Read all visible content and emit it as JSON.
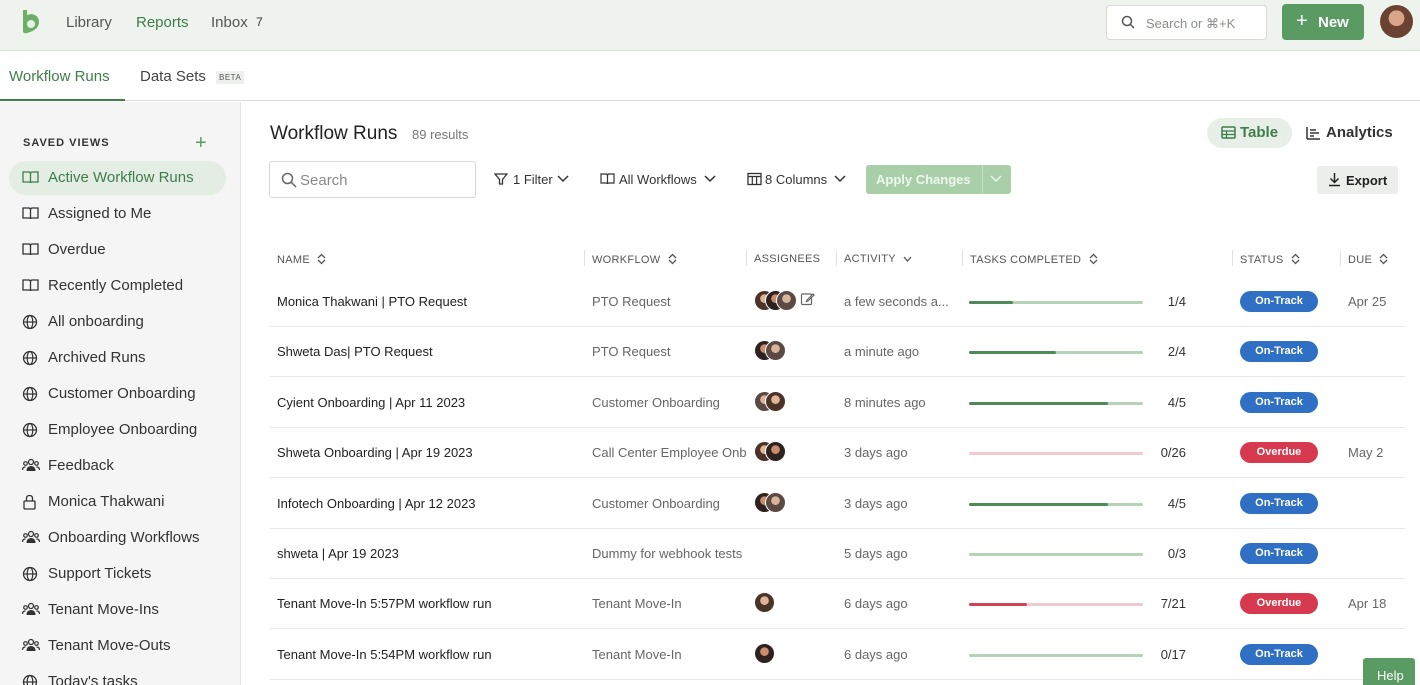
{
  "topnav": {
    "links": [
      "Library",
      "Reports",
      "Inbox"
    ],
    "active": "Reports",
    "inbox_count": "7",
    "search_placeholder": "Search or ⌘+K",
    "new_label": "New"
  },
  "subtabs": {
    "workflow_runs": "Workflow Runs",
    "data_sets": "Data Sets",
    "beta": "BETA"
  },
  "sidebar": {
    "heading": "SAVED VIEWS",
    "add": "+",
    "items": [
      {
        "label": "Active Workflow Runs",
        "icon": "book-icon",
        "active": true
      },
      {
        "label": "Assigned to Me",
        "icon": "book-icon"
      },
      {
        "label": "Overdue",
        "icon": "book-icon"
      },
      {
        "label": "Recently Completed",
        "icon": "book-icon"
      },
      {
        "label": "All onboarding",
        "icon": "globe-icon"
      },
      {
        "label": "Archived Runs",
        "icon": "globe-icon"
      },
      {
        "label": "Customer Onboarding",
        "icon": "globe-icon"
      },
      {
        "label": "Employee Onboarding",
        "icon": "globe-icon"
      },
      {
        "label": "Feedback",
        "icon": "team-icon"
      },
      {
        "label": "Monica Thakwani",
        "icon": "lock-icon"
      },
      {
        "label": "Onboarding Workflows",
        "icon": "team-icon"
      },
      {
        "label": "Support Tickets",
        "icon": "globe-icon"
      },
      {
        "label": "Tenant Move-Ins",
        "icon": "team-icon"
      },
      {
        "label": "Tenant Move-Outs",
        "icon": "team-icon"
      },
      {
        "label": "Today's tasks",
        "icon": "globe-icon"
      }
    ]
  },
  "main": {
    "title": "Workflow Runs",
    "results": "89 results",
    "view_table": "Table",
    "view_analytics": "Analytics",
    "search_placeholder": "Search",
    "filter": "1 Filter",
    "workflows": "All Workflows",
    "columns": "8 Columns",
    "apply": "Apply Changes",
    "export": "Export"
  },
  "table": {
    "headers": {
      "name": "NAME",
      "workflow": "WORKFLOW",
      "assignees": "ASSIGNEES",
      "activity": "ACTIVITY",
      "tasks": "TASKS COMPLETED",
      "status": "STATUS",
      "due": "DUE"
    },
    "rows": [
      {
        "name": "Monica Thakwani | PTO Request",
        "workflow": "PTO Request",
        "activity": "a few seconds a...",
        "done": 1,
        "total": 4,
        "ratio": "1/4",
        "status": "On-Track",
        "due": "Apr 25",
        "avatars": 3,
        "edit": true
      },
      {
        "name": "Shweta Das| PTO Request",
        "workflow": "PTO Request",
        "activity": "a minute ago",
        "done": 2,
        "total": 4,
        "ratio": "2/4",
        "status": "On-Track",
        "due": "",
        "avatars": 2
      },
      {
        "name": "Cyient Onboarding | Apr 11 2023",
        "workflow": "Customer Onboarding",
        "activity": "8 minutes ago",
        "done": 4,
        "total": 5,
        "ratio": "4/5",
        "status": "On-Track",
        "due": "",
        "avatars": 2
      },
      {
        "name": "Shweta Onboarding | Apr 19 2023",
        "workflow": "Call Center Employee Onb",
        "activity": "3 days ago",
        "done": 0,
        "total": 26,
        "ratio": "0/26",
        "status": "Overdue",
        "due": "May 2",
        "avatars": 2
      },
      {
        "name": "Infotech Onboarding | Apr 12 2023",
        "workflow": "Customer Onboarding",
        "activity": "3 days ago",
        "done": 4,
        "total": 5,
        "ratio": "4/5",
        "status": "On-Track",
        "due": "",
        "avatars": 2
      },
      {
        "name": "shweta | Apr 19 2023",
        "workflow": "Dummy for webhook tests",
        "activity": "5 days ago",
        "done": 0,
        "total": 3,
        "ratio": "0/3",
        "status": "On-Track",
        "due": "",
        "avatars": 0
      },
      {
        "name": "Tenant Move-In 5:57PM workflow run",
        "workflow": "Tenant Move-In",
        "activity": "6 days ago",
        "done": 7,
        "total": 21,
        "ratio": "7/21",
        "status": "Overdue",
        "due": "Apr 18",
        "avatars": 1
      },
      {
        "name": "Tenant Move-In 5:54PM workflow run",
        "workflow": "Tenant Move-In",
        "activity": "6 days ago",
        "done": 0,
        "total": 17,
        "ratio": "0/17",
        "status": "On-Track",
        "due": "",
        "avatars": 1
      }
    ]
  },
  "help": "Help",
  "colors": {
    "brand": "#5a9a63",
    "ontrack": "#2f6fc4",
    "overdue": "#d73a4f"
  }
}
